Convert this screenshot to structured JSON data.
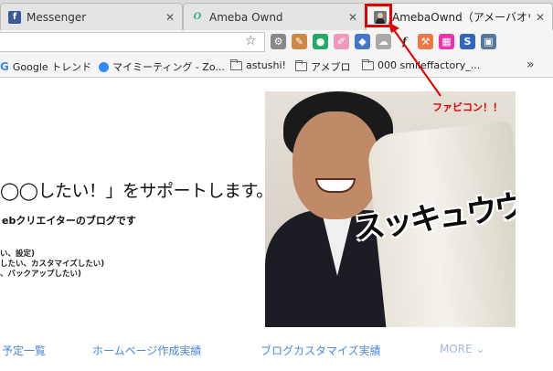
{
  "tabs": [
    {
      "title": "Messenger",
      "favicon": "facebook-icon"
    },
    {
      "title": "Ameba Ownd",
      "favicon": "ameba-ownd-icon"
    },
    {
      "title": "AmebaOwnd（アメーバオウン",
      "favicon": "avatar-favicon"
    }
  ],
  "close_glyph": "✕",
  "bookmarks": [
    {
      "label": "Google トレンド",
      "icon": "google-icon"
    },
    {
      "label": "マイミーティング - Zo...",
      "icon": "zoom-icon"
    },
    {
      "label": "astushi!",
      "icon": "folder-icon"
    },
    {
      "label": "アメブロ",
      "icon": "folder-icon"
    },
    {
      "label": "000 smileffactory_...",
      "icon": "folder-icon"
    }
  ],
  "bookmarks_more": "»",
  "page": {
    "headline": "◯◯したい！」をサポートします。",
    "subhead": "ebクリエイターのブログです",
    "desc_lines": [
      "い、設定)",
      "したい、カスタマイズしたい)",
      "、バックアップしたい)"
    ],
    "photo_text": "スッキュウウン"
  },
  "annotation": "ファビコン！！",
  "nav": {
    "item1": "予定一覧",
    "item2": "ホームページ作成実績",
    "item3": "ブログカスタマイズ実績",
    "more": "MORE ⌄"
  },
  "colors": {
    "annotation": "#e00000",
    "nav_link": "#4a86d9"
  }
}
